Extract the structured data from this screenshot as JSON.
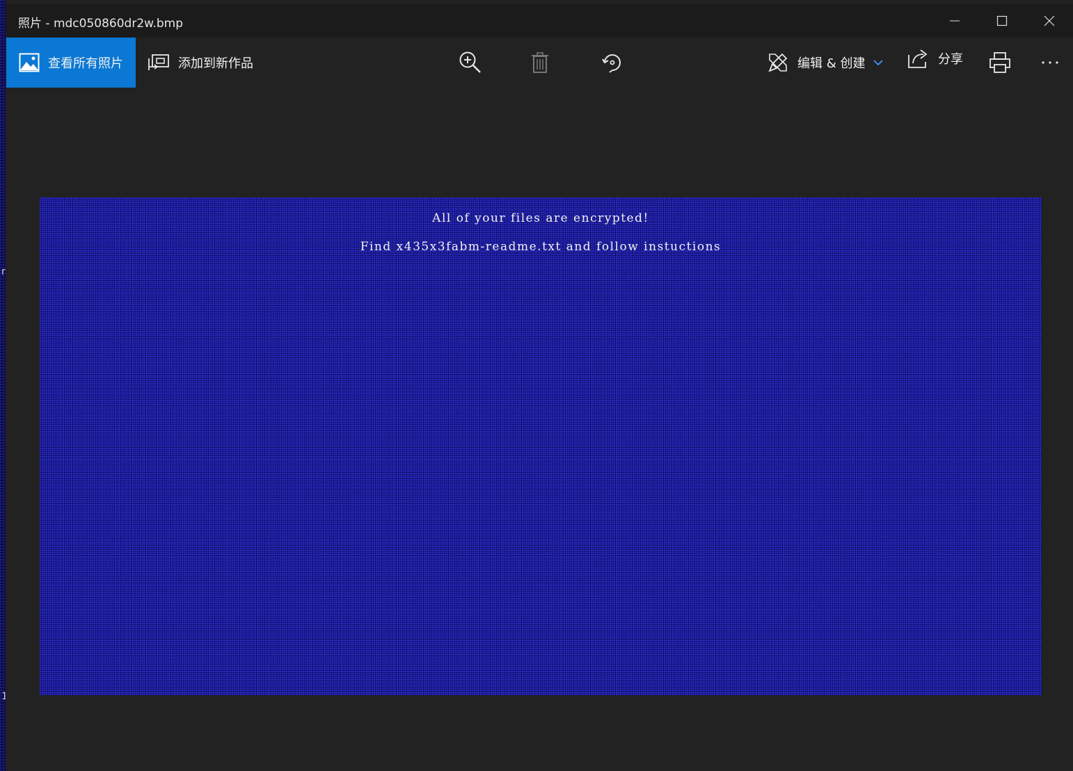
{
  "window": {
    "title": "照片 - mdc050860dr2w.bmp"
  },
  "toolbar": {
    "view_all_label": "查看所有照片",
    "add_to_creation_label": "添加到新作品",
    "edit_create_label": "编辑 & 创建",
    "share_label": "分享"
  },
  "image": {
    "line1": "All of your files are encrypted!",
    "line2": "Find x435x3fabm-readme.txt and follow instuctions"
  },
  "desktop": {
    "edge_chars": [
      "r",
      "1"
    ]
  },
  "colors": {
    "accent": "#0a78d4",
    "toolbar_bg": "#222222",
    "titlebar_bg": "#1b1b1b",
    "image_bg": "#14148a"
  }
}
